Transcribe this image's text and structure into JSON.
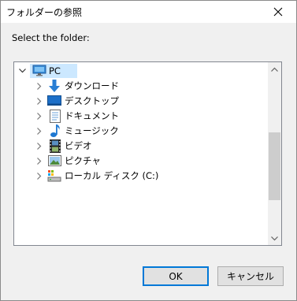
{
  "window": {
    "title": "フォルダーの参照"
  },
  "prompt": "Select the folder:",
  "tree": {
    "root": {
      "label": "PC",
      "icon": "pc-monitor-icon",
      "expanded": true,
      "selected": true
    },
    "children": [
      {
        "label": "ダウンロード",
        "icon": "download-arrow-icon"
      },
      {
        "label": "デスクトップ",
        "icon": "desktop-icon"
      },
      {
        "label": "ドキュメント",
        "icon": "document-icon"
      },
      {
        "label": "ミュージック",
        "icon": "music-note-icon"
      },
      {
        "label": "ビデオ",
        "icon": "video-film-icon"
      },
      {
        "label": "ピクチャ",
        "icon": "picture-icon"
      },
      {
        "label": "ローカル ディスク (C:)",
        "icon": "local-disk-icon"
      }
    ]
  },
  "buttons": {
    "ok": "OK",
    "cancel": "キャンセル"
  },
  "colors": {
    "selection": "#cce8ff",
    "accent": "#0078d7"
  }
}
